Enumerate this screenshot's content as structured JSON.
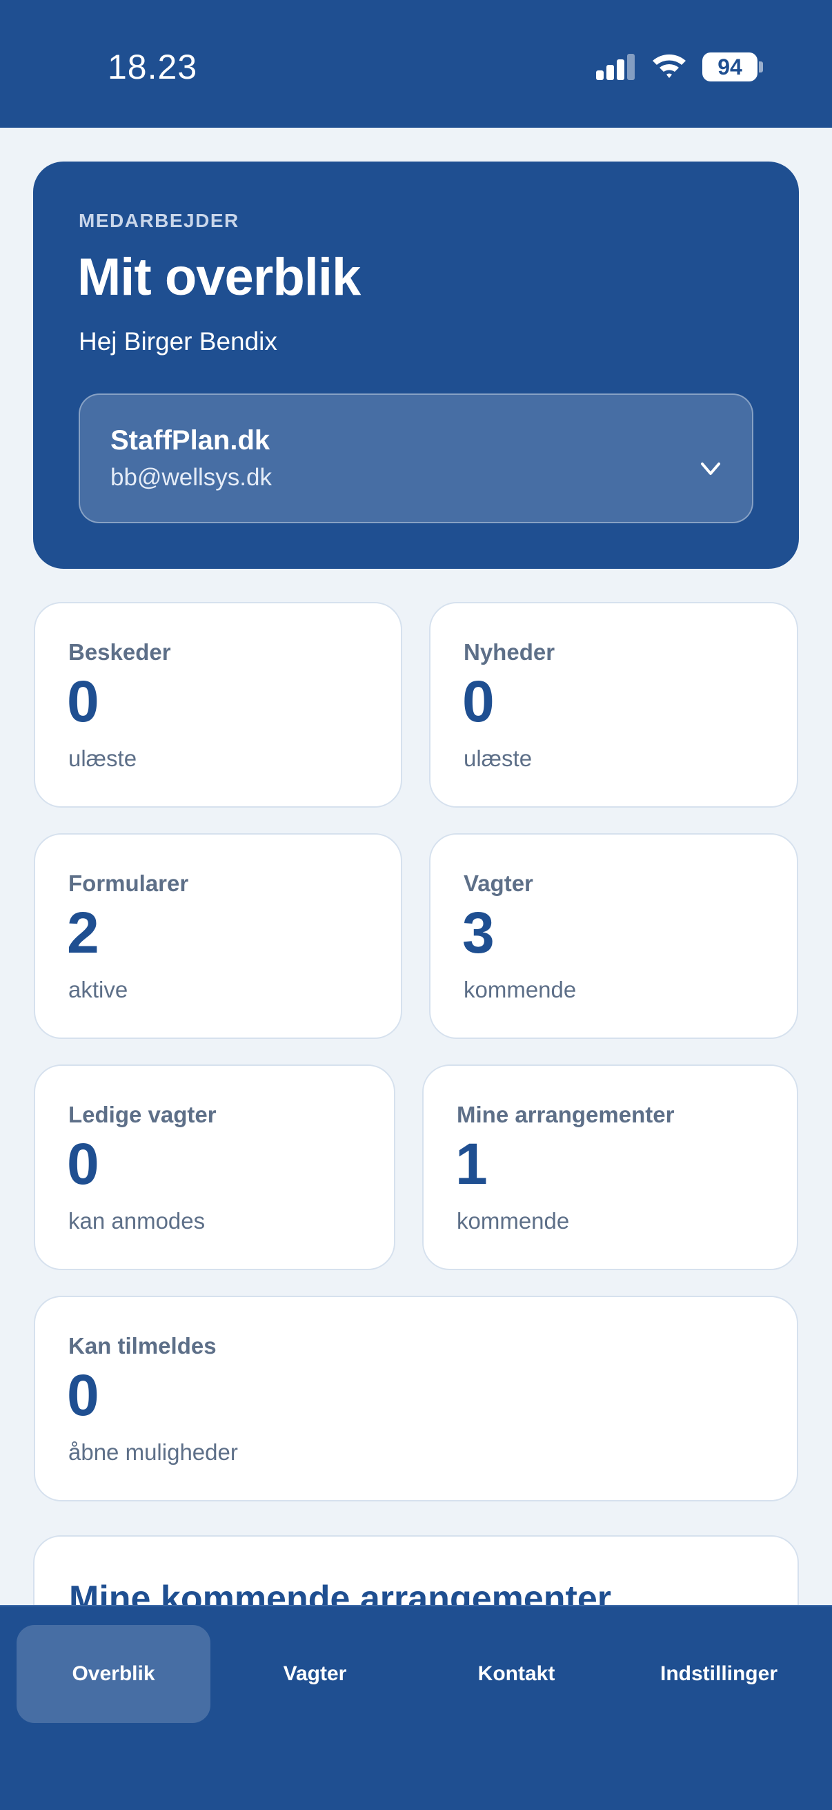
{
  "status": {
    "time": "18.23",
    "battery": "94"
  },
  "hero": {
    "eyebrow": "MEDARBEJDER",
    "title": "Mit overblik",
    "greeting": "Hej Birger Bendix",
    "org_name": "StaffPlan.dk",
    "org_email": "bb@wellsys.dk"
  },
  "cards": [
    {
      "label": "Beskeder",
      "value": "0",
      "sub": "ulæste"
    },
    {
      "label": "Nyheder",
      "value": "0",
      "sub": "ulæste"
    },
    {
      "label": "Formularer",
      "value": "2",
      "sub": "aktive"
    },
    {
      "label": "Vagter",
      "value": "3",
      "sub": "kommende"
    },
    {
      "label": "Ledige vagter",
      "value": "0",
      "sub": "kan anmodes"
    },
    {
      "label": "Mine arrangementer",
      "value": "1",
      "sub": "kommende"
    },
    {
      "label": "Kan tilmeldes",
      "value": "0",
      "sub": "åbne muligheder"
    }
  ],
  "section": {
    "title": "Mine kommende arrangementer"
  },
  "nav": [
    {
      "label": "Overblik",
      "active": true
    },
    {
      "label": "Vagter",
      "active": false
    },
    {
      "label": "Kontakt",
      "active": false
    },
    {
      "label": "Indstillinger",
      "active": false
    }
  ],
  "colors": {
    "primary": "#1f4f91",
    "background": "#eef3f8",
    "muted_text": "#5d6f88"
  }
}
